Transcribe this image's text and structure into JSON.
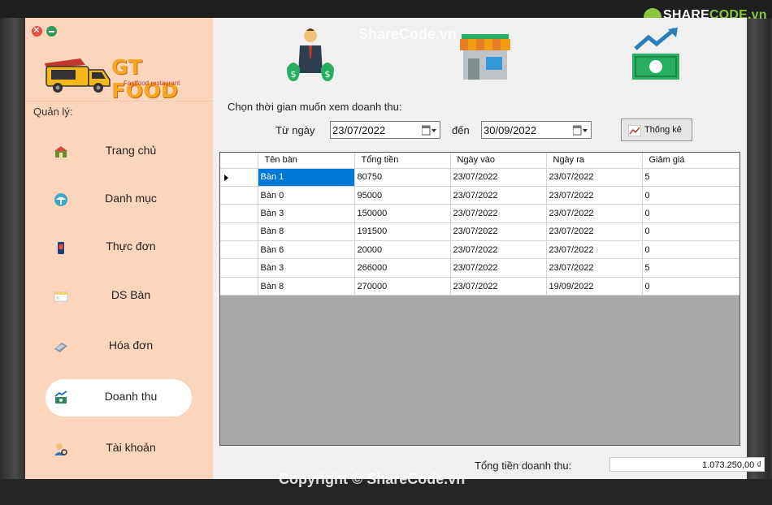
{
  "watermark": {
    "site": "ShareCode.vn",
    "copyright": "Copyright © ShareCode.vn",
    "logo_prefix": "SHARE",
    "logo_suffix": "CODE.vn"
  },
  "sidebar": {
    "brand": "GT FOOD",
    "tagline": "Fastfood restaurant",
    "section_label": "Quản lý:",
    "items": [
      {
        "label": "Trang chủ",
        "icon": "home-icon"
      },
      {
        "label": "Danh mục",
        "icon": "category-icon"
      },
      {
        "label": "Thực đơn",
        "icon": "menu-icon"
      },
      {
        "label": "DS Bàn",
        "icon": "table-list-icon"
      },
      {
        "label": "Hóa đơn",
        "icon": "invoice-icon"
      },
      {
        "label": "Doanh thu",
        "icon": "revenue-icon",
        "active": true
      },
      {
        "label": "Tài khoản",
        "icon": "account-icon"
      }
    ]
  },
  "filter": {
    "prompt": "Chọn thời gian muốn xem doanh thu:",
    "from_label": "Từ ngày",
    "from_value": "23/07/2022",
    "to_label": "đến",
    "to_value": "30/09/2022",
    "stats_button": "Thống kê"
  },
  "table": {
    "columns": [
      "Tên bàn",
      "Tổng tiền",
      "Ngày vào",
      "Ngày ra",
      "Giảm giá"
    ],
    "rows": [
      [
        "Bàn 1",
        "80750",
        "23/07/2022",
        "23/07/2022",
        "5"
      ],
      [
        "Bàn 0",
        "95000",
        "23/07/2022",
        "23/07/2022",
        "0"
      ],
      [
        "Bàn 3",
        "150000",
        "23/07/2022",
        "23/07/2022",
        "0"
      ],
      [
        "Bàn 8",
        "191500",
        "23/07/2022",
        "23/07/2022",
        "0"
      ],
      [
        "Bàn 6",
        "20000",
        "23/07/2022",
        "23/07/2022",
        "0"
      ],
      [
        "Bàn 3",
        "266000",
        "23/07/2022",
        "23/07/2022",
        "5"
      ],
      [
        "Bàn 8",
        "270000",
        "23/07/2022",
        "19/09/2022",
        "0"
      ]
    ]
  },
  "total": {
    "label": "Tổng tiền doanh thu:",
    "value": "1.073.250,00 ₫"
  },
  "colors": {
    "sidebar": "#fcd5bd",
    "selection": "#0078d7",
    "grid_empty": "#a9a9a9",
    "brand": "#f5a623"
  }
}
